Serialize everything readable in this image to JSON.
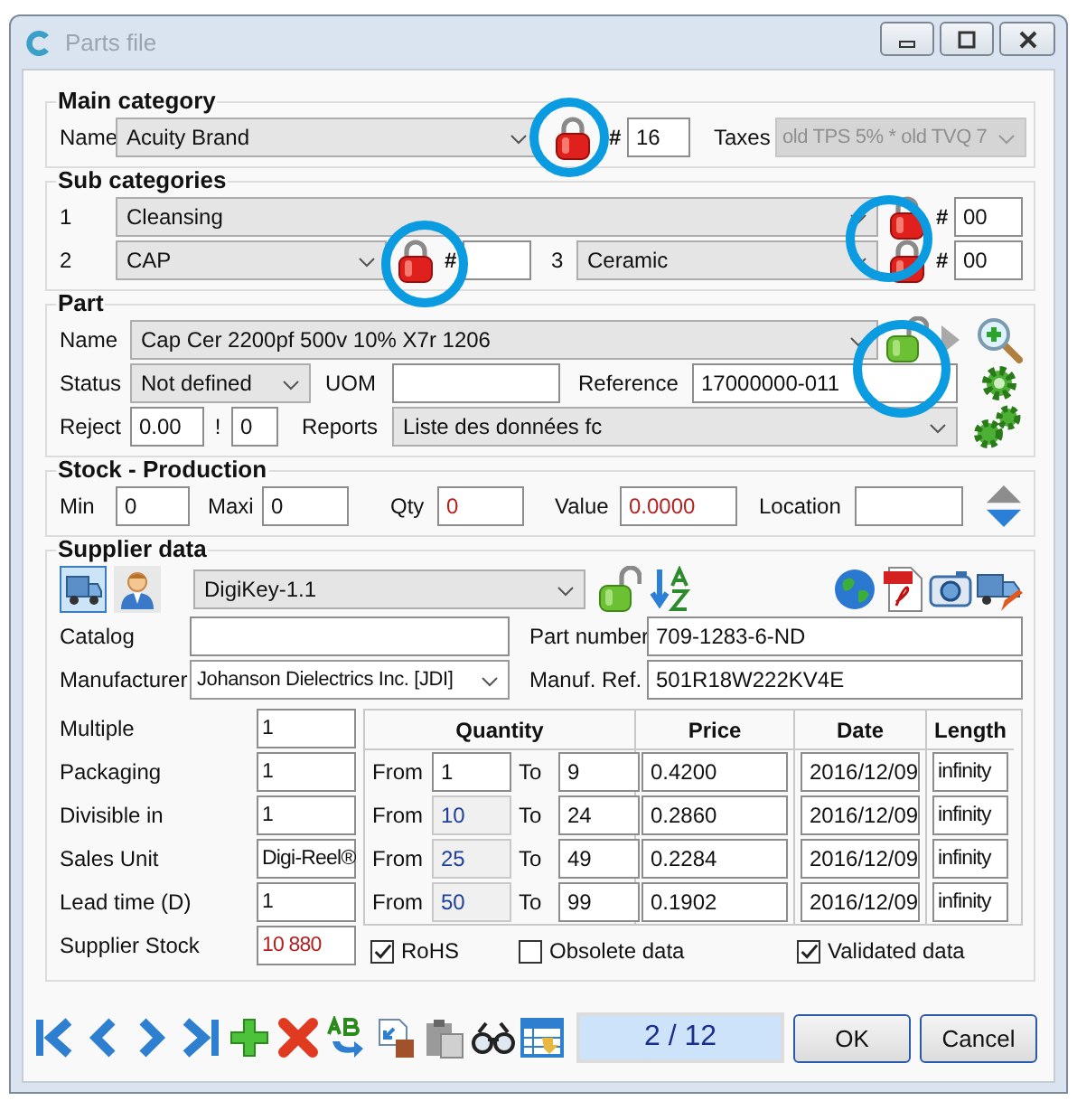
{
  "window": {
    "title": "Parts file"
  },
  "main_category": {
    "heading": "Main category",
    "name_label": "Name",
    "name": "Acuity Brand",
    "locked": true,
    "number_label": "#",
    "number": "16",
    "taxes_label": "Taxes",
    "taxes": "old TPS 5% * old TVQ 7",
    "taxes_disabled": true
  },
  "sub_categories": {
    "heading": "Sub categories",
    "rows": [
      [
        {
          "index": "1",
          "value": "Cleansing",
          "locked": true,
          "number_label": "#",
          "number": "00"
        }
      ],
      [
        {
          "index": "2",
          "value": "CAP",
          "locked": true,
          "number_label": "#"
        },
        {
          "index": "3",
          "value": "Ceramic",
          "locked": true,
          "number_label": "#",
          "number": "00"
        }
      ]
    ]
  },
  "part": {
    "heading": "Part",
    "name_label": "Name",
    "name": "Cap Cer 2200pf 500v 10% X7r 1206",
    "locked": false,
    "status_label": "Status",
    "status": "Not defined",
    "uom_label": "UOM",
    "reference_label": "Reference",
    "reference": "17000000-011",
    "reject_label": "Reject",
    "reject": "0.00",
    "reject_separator": "!",
    "reject_count": "0",
    "reports_label": "Reports",
    "reports": "Liste des données fc"
  },
  "stock": {
    "heading": "Stock - Production",
    "fields": [
      {
        "label": "Min",
        "value": "0",
        "alert": false
      },
      {
        "label": "Maxi",
        "value": "0",
        "alert": false
      },
      {
        "label": "Qty",
        "value": "0",
        "alert": true
      },
      {
        "label": "Value",
        "value": "0.0000",
        "alert": true
      },
      {
        "label": "Location"
      }
    ]
  },
  "supplier": {
    "heading": "Supplier data",
    "views": [
      {
        "kind": "truck",
        "selected": true
      },
      {
        "kind": "person",
        "selected": false
      }
    ],
    "name": "DigiKey-1.1",
    "locked": false,
    "catalog_label": "Catalog",
    "part_number_label": "Part number",
    "part_number": "709-1283-6-ND",
    "manufacturer_label": "Manufacturer",
    "manufacturer": "Johanson Dielectrics Inc. [JDI]",
    "manuf_ref_label": "Manuf. Ref.",
    "manuf_ref": "501R18W222KV4E",
    "fields": [
      {
        "label": "Multiple",
        "value": "1",
        "alert": false
      },
      {
        "label": "Packaging",
        "value": "1",
        "alert": false
      },
      {
        "label": "Divisible in",
        "value": "1",
        "alert": false
      },
      {
        "label": "Sales Unit",
        "value": "Digi-Reel®",
        "alert": false
      },
      {
        "label": "Lead time (D)",
        "value": "1",
        "alert": false
      },
      {
        "label": "Supplier Stock",
        "value": "10 880",
        "alert": true
      }
    ],
    "price_table": {
      "columns": [
        "Quantity",
        "Price",
        "Date",
        "Length"
      ],
      "rows": [
        {
          "from_label": "From",
          "from": "1",
          "computed": false,
          "to_label": "To",
          "to": "9",
          "price": "0.4200",
          "date": "2016/12/09",
          "length": "infinity"
        },
        {
          "from_label": "From",
          "from": "10",
          "computed": true,
          "to_label": "To",
          "to": "24",
          "price": "0.2860",
          "date": "2016/12/09",
          "length": "infinity"
        },
        {
          "from_label": "From",
          "from": "25",
          "computed": true,
          "to_label": "To",
          "to": "49",
          "price": "0.2284",
          "date": "2016/12/09",
          "length": "infinity"
        },
        {
          "from_label": "From",
          "from": "50",
          "computed": true,
          "to_label": "To",
          "to": "99",
          "price": "0.1902",
          "date": "2016/12/09",
          "length": "infinity"
        }
      ]
    },
    "options": [
      {
        "label": "RoHS",
        "checked": true
      },
      {
        "label": "Obsolete data",
        "checked": false
      },
      {
        "label": "Validated data",
        "checked": true
      }
    ]
  },
  "footer": {
    "counter": "2 / 12",
    "buttons": [
      "OK",
      "Cancel"
    ]
  }
}
